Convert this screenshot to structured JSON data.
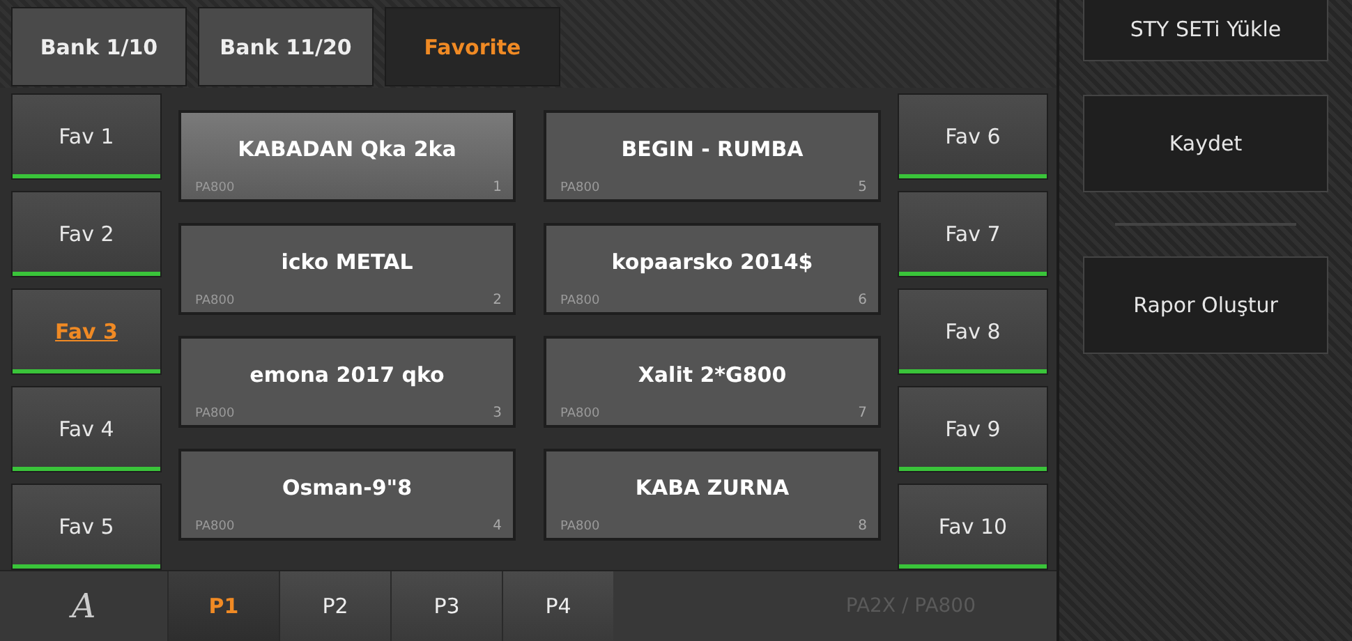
{
  "bank_tabs": [
    {
      "label": "Bank 1/10",
      "selected": false
    },
    {
      "label": "Bank 11/20",
      "selected": false
    },
    {
      "label": "Favorite",
      "selected": true
    }
  ],
  "favorites_left": [
    {
      "label": "Fav 1",
      "selected": false
    },
    {
      "label": "Fav 2",
      "selected": false
    },
    {
      "label": "Fav 3",
      "selected": true
    },
    {
      "label": "Fav 4",
      "selected": false
    },
    {
      "label": "Fav 5",
      "selected": false
    }
  ],
  "favorites_right": [
    {
      "label": "Fav 6",
      "selected": false
    },
    {
      "label": "Fav 7",
      "selected": false
    },
    {
      "label": "Fav 8",
      "selected": false
    },
    {
      "label": "Fav 9",
      "selected": false
    },
    {
      "label": "Fav 10",
      "selected": false
    }
  ],
  "styles": [
    {
      "name": "KABADAN Qka 2ka",
      "model": "PA800",
      "number": "1",
      "selected": true
    },
    {
      "name": "BEGIN - RUMBA",
      "model": "PA800",
      "number": "5",
      "selected": false
    },
    {
      "name": "icko METAL",
      "model": "PA800",
      "number": "2",
      "selected": false
    },
    {
      "name": "kopaarsko 2014$",
      "model": "PA800",
      "number": "6",
      "selected": false
    },
    {
      "name": "emona 2017 qko",
      "model": "PA800",
      "number": "3",
      "selected": false
    },
    {
      "name": "Xalit 2*G800",
      "model": "PA800",
      "number": "7",
      "selected": false
    },
    {
      "name": "Osman-9\"8",
      "model": "PA800",
      "number": "4",
      "selected": false
    },
    {
      "name": "KABA ZURNA",
      "model": "PA800",
      "number": "8",
      "selected": false
    }
  ],
  "bottom_bar": {
    "logo": "A",
    "pages": [
      {
        "label": "P1",
        "selected": true
      },
      {
        "label": "P2",
        "selected": false
      },
      {
        "label": "P3",
        "selected": false
      },
      {
        "label": "P4",
        "selected": false
      }
    ],
    "device": "PA2X / PA800"
  },
  "side_buttons": [
    "STY SETi Yükle",
    "Kaydet",
    "Rapor Oluştur"
  ]
}
